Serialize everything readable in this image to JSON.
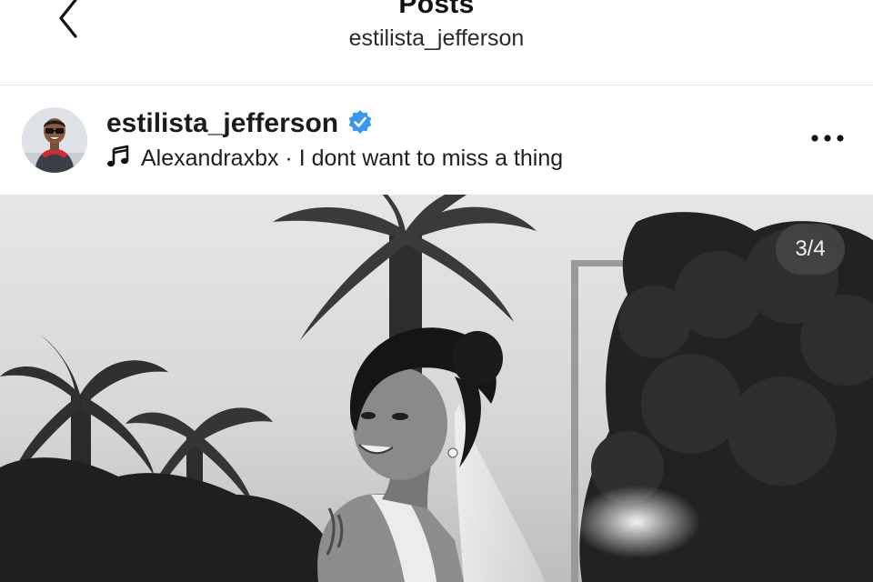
{
  "nav": {
    "title": "Posts",
    "subtitle": "estilista_jefferson",
    "back_icon": "chevron-left-icon"
  },
  "post": {
    "username": "estilista_jefferson",
    "verified": true,
    "verified_color": "#3897f0",
    "audio_icon": "music-note-icon",
    "audio_label": "Alexandraxbx · I dont want to miss a thing",
    "more_icon": "more-horizontal-icon",
    "media_counter": "3/4"
  }
}
